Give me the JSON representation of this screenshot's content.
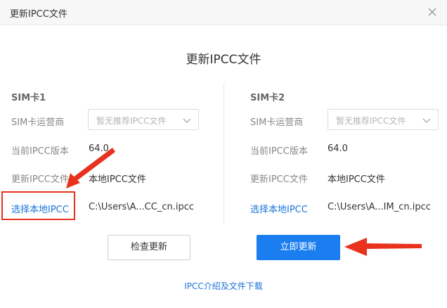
{
  "window": {
    "title": "更新IPCC文件"
  },
  "heading": "更新IPCC文件",
  "sim1": {
    "title": "SIM卡1",
    "carrier_label": "SIM卡运营商",
    "carrier_placeholder": "暂无推荐IPCC文件",
    "version_label": "当前IPCC版本",
    "version_value": "64.0",
    "update_label": "更新IPCC文件",
    "update_value": "本地IPCC文件",
    "choose_link": "选择本地IPCC",
    "file_path": "C:\\Users\\A...CC_cn.ipcc"
  },
  "sim2": {
    "title": "SIM卡2",
    "carrier_label": "SIM卡运营商",
    "carrier_placeholder": "暂无推荐IPCC文件",
    "version_label": "当前IPCC版本",
    "version_value": "64.0",
    "update_label": "更新IPCC文件",
    "update_value": "本地IPCC文件",
    "choose_link": "选择本地IPCC",
    "file_path": "C:\\Users\\A...IM_cn.ipcc"
  },
  "buttons": {
    "check": "检查更新",
    "update": "立即更新"
  },
  "footer_link": "IPCC介绍及文件下载",
  "icons": {
    "close": "close-icon",
    "dropdown": "chevron-down-icon"
  },
  "colors": {
    "primary": "#1a7df0",
    "link": "#1a73d9",
    "annotation": "#e8321e"
  }
}
